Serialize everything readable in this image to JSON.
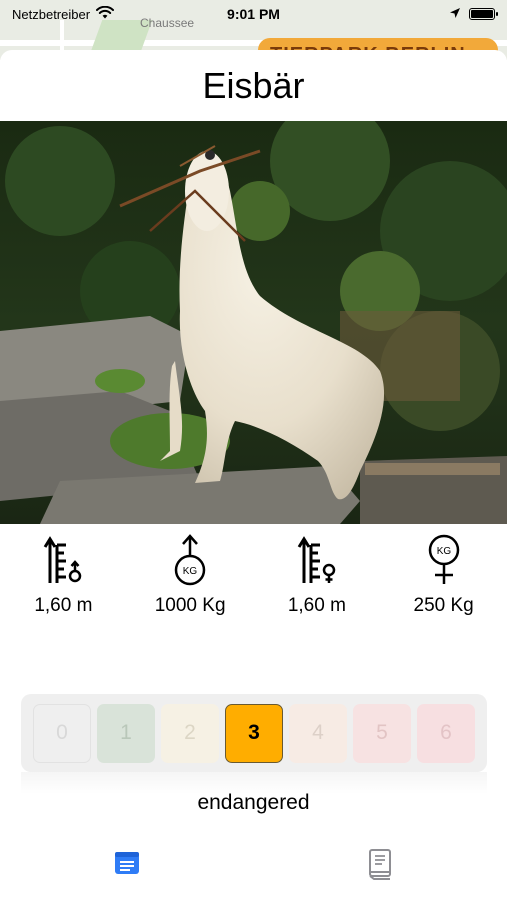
{
  "status_bar": {
    "carrier": "Netzbetreiber",
    "time": "9:01 PM"
  },
  "background_map": {
    "street_label": "Chaussee",
    "badge_label": "TIERPARK BERLIN"
  },
  "animal": {
    "name": "Eisbär",
    "photo_description_icon": "polar-bear-photo"
  },
  "stats": [
    {
      "icon": "male-height-icon",
      "value": "1,60 m"
    },
    {
      "icon": "male-weight-icon",
      "value": "1000 Kg"
    },
    {
      "icon": "female-height-icon",
      "value": "1,60 m"
    },
    {
      "icon": "female-weight-icon",
      "value": "250 Kg"
    }
  ],
  "conservation": {
    "levels": [
      {
        "label": "0",
        "bg": "#efefef",
        "fg": "#d8d8d8",
        "border": "#e2e2e2"
      },
      {
        "label": "1",
        "bg": "#d9e3d9",
        "fg": "#b9c7b9",
        "border": "#d9e3d9"
      },
      {
        "label": "2",
        "bg": "#f6f1e4",
        "fg": "#dcd6c5",
        "border": "#f6f1e4"
      },
      {
        "label": "3",
        "bg": "#ffad00",
        "fg": "#000000",
        "border": "#6a5a30"
      },
      {
        "label": "4",
        "bg": "#f7ebe4",
        "fg": "#ddd0c8",
        "border": "#f7ebe4"
      },
      {
        "label": "5",
        "bg": "#f7e2e2",
        "fg": "#e2c4c4",
        "border": "#f7e2e2"
      },
      {
        "label": "6",
        "bg": "#f7dfe1",
        "fg": "#e3c3c6",
        "border": "#f7dfe1"
      }
    ],
    "selected": "3",
    "status_text": "endangered"
  },
  "tabbar": {
    "tabs": [
      {
        "icon": "info-card-icon",
        "active": true
      },
      {
        "icon": "book-icon",
        "active": false
      }
    ],
    "accent": "#2f7cf6",
    "inactive": "#8e8e93"
  }
}
